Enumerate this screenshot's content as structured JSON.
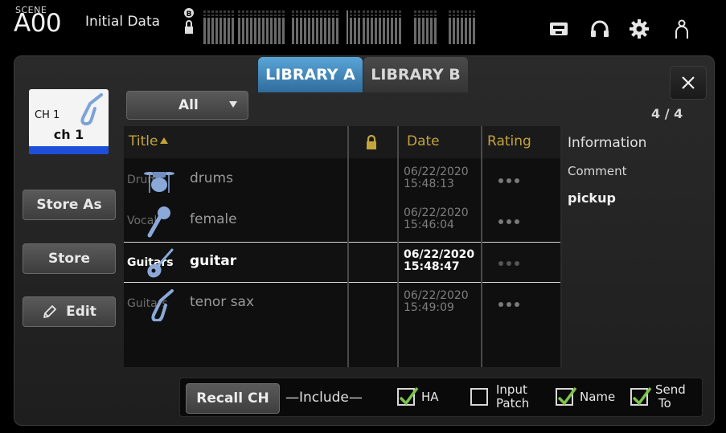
{
  "topbar": {
    "scene_label": "SCENE",
    "scene_number": "A00",
    "scene_name": "Initial Data"
  },
  "tabs": [
    {
      "label": "LIBRARY A",
      "active": true
    },
    {
      "label": "LIBRARY B",
      "active": false
    }
  ],
  "channel": {
    "label": "CH 1",
    "name": "ch 1",
    "color": "#1d4fd8"
  },
  "side_buttons": {
    "store_as": "Store As",
    "store": "Store",
    "edit": "Edit"
  },
  "filter": {
    "value": "All"
  },
  "count": "4 / 4",
  "list": {
    "headers": {
      "title": "Title",
      "date": "Date",
      "rating": "Rating"
    },
    "rows": [
      {
        "category": "Drums",
        "title": "drums",
        "date": "06/22/2020",
        "time": "15:48:13",
        "icon": "drum-kit-icon",
        "selected": false
      },
      {
        "category": "Vocal",
        "title": "female",
        "date": "06/22/2020",
        "time": "15:46:04",
        "icon": "microphone-icon",
        "selected": false
      },
      {
        "category": "Guitars",
        "title": "guitar",
        "date": "06/22/2020",
        "time": "15:48:47",
        "icon": "acoustic-guitar-icon",
        "selected": true
      },
      {
        "category": "Guitars",
        "title": "tenor sax",
        "date": "06/22/2020",
        "time": "15:49:09",
        "icon": "saxophone-icon",
        "selected": false
      }
    ]
  },
  "information": {
    "heading": "Information",
    "comment_label": "Comment",
    "comment": "pickup"
  },
  "bottom": {
    "recall": "Recall CH",
    "include": "—Include—",
    "options": [
      {
        "line1": "HA",
        "line2": "",
        "checked": true
      },
      {
        "line1": "Input",
        "line2": "Patch",
        "checked": false
      },
      {
        "line1": "Name",
        "line2": "",
        "checked": true
      },
      {
        "line1": "Send",
        "line2": "To",
        "checked": true
      }
    ]
  },
  "colors": {
    "accent_tab": "#3f87c0",
    "header_text": "#c4a33c",
    "check": "#7ec44a",
    "channel_strip": "#1d4fd8"
  }
}
